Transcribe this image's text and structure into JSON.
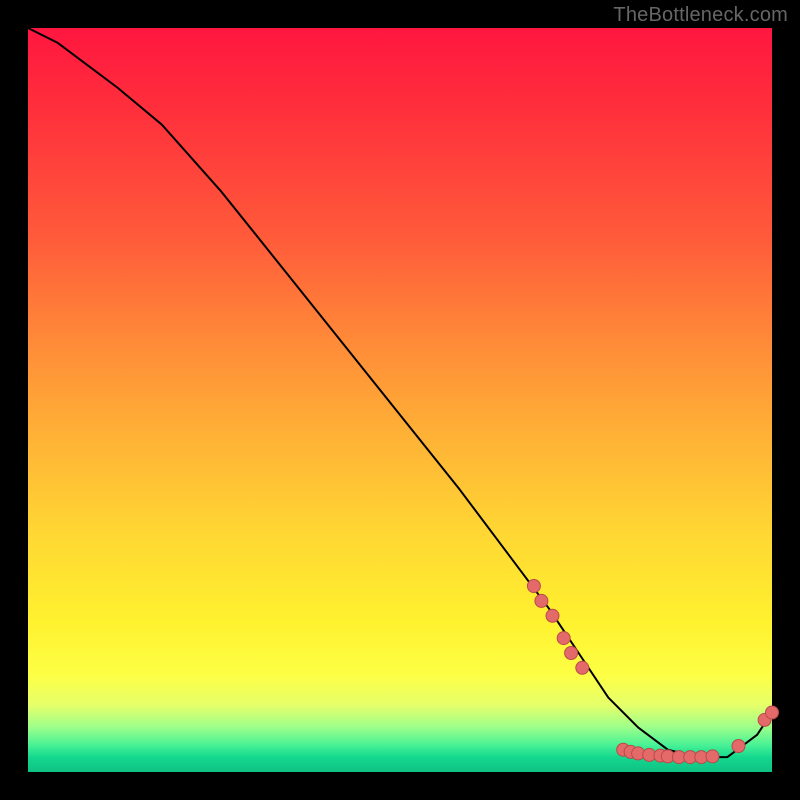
{
  "watermark": "TheBottleneck.com",
  "colors": {
    "marker_fill": "#e46a6a",
    "marker_stroke": "#b94a4a",
    "curve": "#000000"
  },
  "chart_data": {
    "type": "line",
    "title": "",
    "xlabel": "",
    "ylabel": "",
    "xlim": [
      0,
      100
    ],
    "ylim": [
      0,
      100
    ],
    "grid": false,
    "legend": false,
    "series": [
      {
        "name": "curve",
        "x": [
          0,
          4,
          8,
          12,
          18,
          26,
          34,
          42,
          50,
          58,
          64,
          70,
          74,
          78,
          82,
          86,
          90,
          94,
          98,
          100
        ],
        "y": [
          100,
          98,
          95,
          92,
          87,
          78,
          68,
          58,
          48,
          38,
          30,
          22,
          16,
          10,
          6,
          3,
          2,
          2,
          5,
          8
        ]
      }
    ],
    "markers": [
      {
        "x": 68,
        "y": 25
      },
      {
        "x": 69,
        "y": 23
      },
      {
        "x": 70.5,
        "y": 21
      },
      {
        "x": 72,
        "y": 18
      },
      {
        "x": 73,
        "y": 16
      },
      {
        "x": 74.5,
        "y": 14
      },
      {
        "x": 80,
        "y": 3.0
      },
      {
        "x": 81,
        "y": 2.7
      },
      {
        "x": 82,
        "y": 2.5
      },
      {
        "x": 83.5,
        "y": 2.3
      },
      {
        "x": 85,
        "y": 2.2
      },
      {
        "x": 86,
        "y": 2.1
      },
      {
        "x": 87.5,
        "y": 2.0
      },
      {
        "x": 89,
        "y": 2.0
      },
      {
        "x": 90.5,
        "y": 2.0
      },
      {
        "x": 92,
        "y": 2.1
      },
      {
        "x": 95.5,
        "y": 3.5
      },
      {
        "x": 99,
        "y": 7.0
      },
      {
        "x": 100,
        "y": 8.0
      }
    ]
  }
}
